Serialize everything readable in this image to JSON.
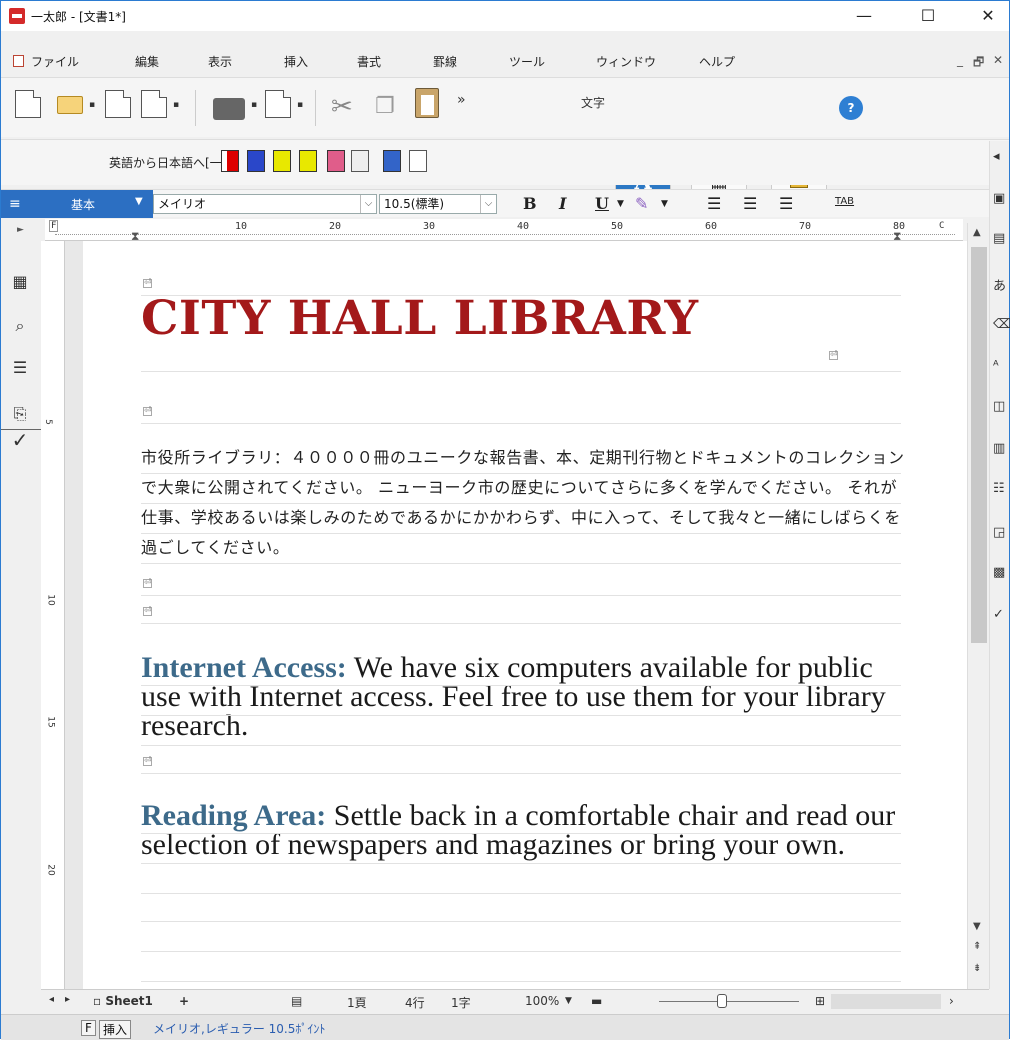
{
  "window": {
    "title": "一太郎 - [文書1*]",
    "controls": {
      "minimize": "—",
      "maximize": "☐",
      "close": "✕"
    }
  },
  "menu": [
    "ファイル",
    "編集",
    "表示",
    "挿入",
    "書式",
    "罫線",
    "ツール",
    "ウィンドウ",
    "ヘルプ"
  ],
  "mdi_controls": {
    "minimize": "_",
    "restore": "🗗",
    "close": "✕"
  },
  "toolbar": {
    "more_label": "»",
    "text_mode_label": "文字",
    "mode_A": "A",
    "help": "?"
  },
  "dictbar": {
    "mode_label": "英語から日本語へ[一般]"
  },
  "format": {
    "style": "基本",
    "font": "メイリオ",
    "size": "10.5(標準)",
    "bold": "B",
    "italic": "I",
    "underline": "U",
    "tab": "TAB"
  },
  "ruler": {
    "numbers": [
      "10",
      "20",
      "30",
      "40",
      "50",
      "60",
      "70",
      "80"
    ],
    "left_corner": "F",
    "right_corner": "C"
  },
  "vruler": [
    "5",
    "10",
    "15",
    "20"
  ],
  "document": {
    "title": "CITY HALL LIBRARY",
    "paragraph": "市役所ライブラリ：４００００冊のユニークな報告書、本、定期刊行物とドキュメントのコレクションで大衆に公開されてください。 ニューヨーク市の歴史についてさらに多くを学んでください。 それが仕事、学校あるいは楽しみのためであるかにかかわらず、中に入って、そして我々と一緒にしばらくを過ごしてください。",
    "sections": [
      {
        "heading": "Internet Access:",
        "body": " We have six computers available for public use with Internet access. Feel free to use them for your library research."
      },
      {
        "heading": "Reading Area:",
        "body": " Settle back in a comfortable chair and read our selection of newspapers and magazines or bring your own."
      }
    ],
    "paragraph_mark": "⏎"
  },
  "sheetbar": {
    "sheet_name": "Sheet1",
    "add": "+",
    "page": "1頁",
    "line": "4行",
    "char": "1字",
    "zoom": "100%"
  },
  "statusbar": {
    "input_mode": "F",
    "insert_mode": "挿入",
    "font_info": "メイリオ,レギュラー  10.5ﾎﾟｲﾝﾄ"
  }
}
